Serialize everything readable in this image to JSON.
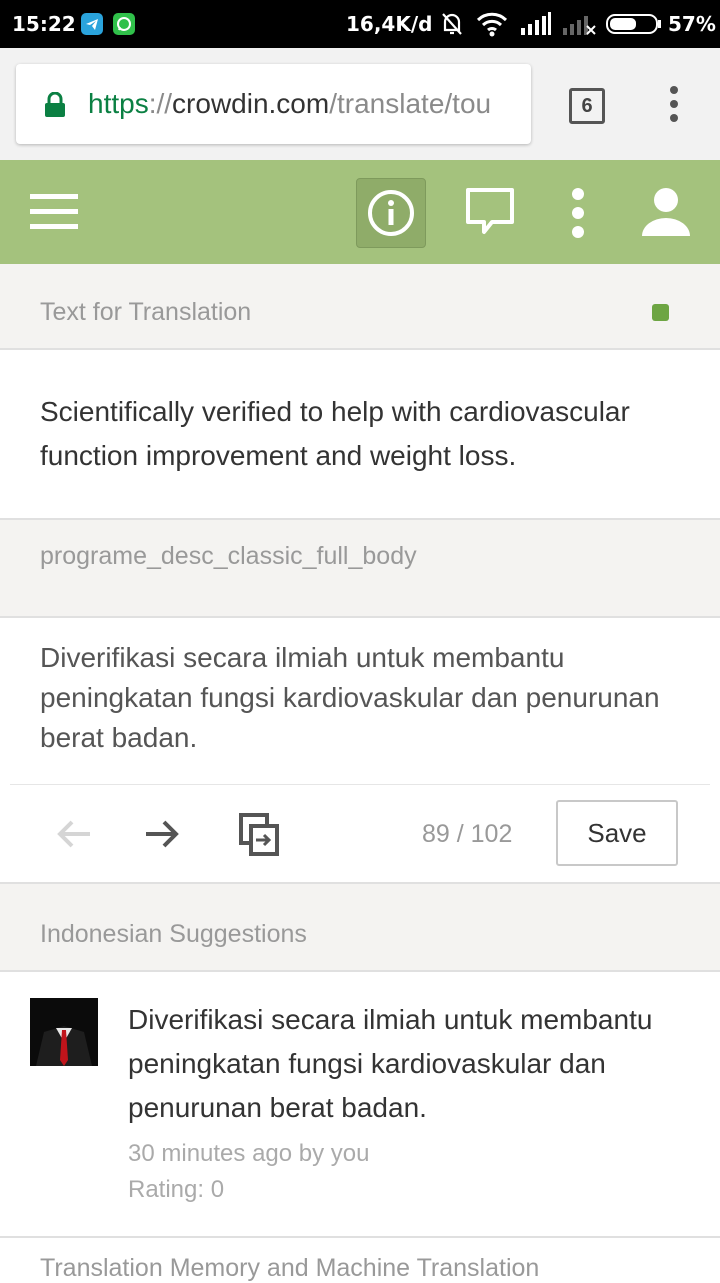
{
  "status_bar": {
    "time": "15:22",
    "network_speed": "16,4K/d",
    "battery": "57%",
    "icons": [
      "telegram-icon",
      "whatsapp-icon",
      "bell-off-icon",
      "wifi-icon",
      "signal-icon",
      "no-signal-icon",
      "battery-icon"
    ]
  },
  "browser": {
    "url_scheme": "https",
    "url_sep": "://",
    "url_domain": "crowdin.com",
    "url_path": "/translate/tou",
    "tab_count": "6"
  },
  "app_header": {
    "icons": [
      "menu-icon",
      "info-icon",
      "comment-icon",
      "more-vert-icon",
      "user-icon"
    ],
    "accent_color": "#a4c27d"
  },
  "source": {
    "header": "Text for Translation",
    "status_color": "#6da543",
    "text": "Scientifically verified to help with cardiovascular function improvement and weight loss.",
    "key": "programe_desc_classic_full_body"
  },
  "translation": {
    "text": "Diverifikasi secara ilmiah untuk membantu peningkatan fungsi kardiovaskular dan penurunan berat badan.",
    "counter": "89 / 102",
    "save_label": "Save"
  },
  "suggestions": {
    "header": "Indonesian Suggestions",
    "items": [
      {
        "text": "Diverifikasi secara ilmiah untuk membantu peningkatan fungsi kardiovaskular dan penurunan berat badan.",
        "meta": "30 minutes ago by you",
        "rating": "Rating: 0"
      }
    ]
  },
  "tm": {
    "header": "Translation Memory and Machine Translation"
  }
}
